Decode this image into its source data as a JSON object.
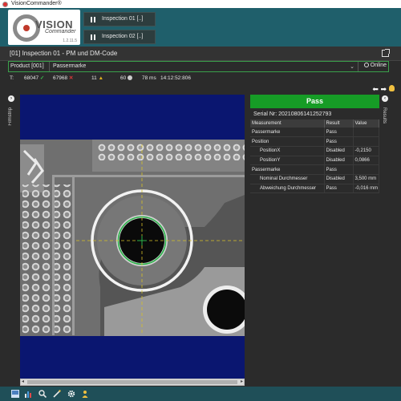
{
  "window": {
    "title": "VisionCommander®"
  },
  "logo": {
    "word1": "VISION",
    "word2": "Commander",
    "version": "1.2.11.5"
  },
  "inspections": [
    {
      "label": "Inspection 01 [..]"
    },
    {
      "label": "Inspection 02 [..]"
    }
  ],
  "tab": {
    "title": "[01] Inspection 01 - PM und DM-Code"
  },
  "product": {
    "label": "Product [001]",
    "value": "Passermarke",
    "online_label": "Online"
  },
  "stats": {
    "t_label": "T:",
    "pass_count": "68047",
    "fail_count": "67968",
    "warn_count": "11",
    "other_count": "60",
    "time_ms": "78 ms",
    "timestamp": "14:12:52:806"
  },
  "side": {
    "filmstrip": "Filmstrip",
    "results": "Results"
  },
  "results": {
    "status": "Pass",
    "serial": "Serial Nr: 20210806141252793",
    "columns": [
      "Measurement",
      "Result",
      "Value"
    ],
    "rows": [
      {
        "measurement": "Passermarke",
        "result": "Pass",
        "value": "",
        "indent": false
      },
      {
        "measurement": "Position",
        "result": "Pass",
        "value": "",
        "indent": false
      },
      {
        "measurement": "PositionX",
        "result": "Disabled",
        "value": "-0,2150",
        "indent": true
      },
      {
        "measurement": "PositionY",
        "result": "Disabled",
        "value": "0,0866",
        "indent": true
      },
      {
        "measurement": "Passermarke",
        "result": "Pass",
        "value": "",
        "indent": false
      },
      {
        "measurement": "Nominal Durchmesser",
        "result": "Disabled",
        "value": "3,500 mm",
        "indent": true
      },
      {
        "measurement": "Abweichung Durchmesser",
        "result": "Pass",
        "value": "-0,016 mm",
        "indent": true
      }
    ]
  },
  "colors": {
    "pass": "#169c26",
    "header": "#1f5f6b",
    "viewer_bg": "#0a1670",
    "accent_green": "#3aa04a"
  },
  "icons": {
    "taskbar": [
      "layout-icon",
      "chart-icon",
      "search-icon",
      "wand-icon",
      "settings-icon",
      "user-icon"
    ],
    "nav": [
      "arrow-left-icon",
      "arrow-right-icon",
      "bulb-icon"
    ]
  }
}
